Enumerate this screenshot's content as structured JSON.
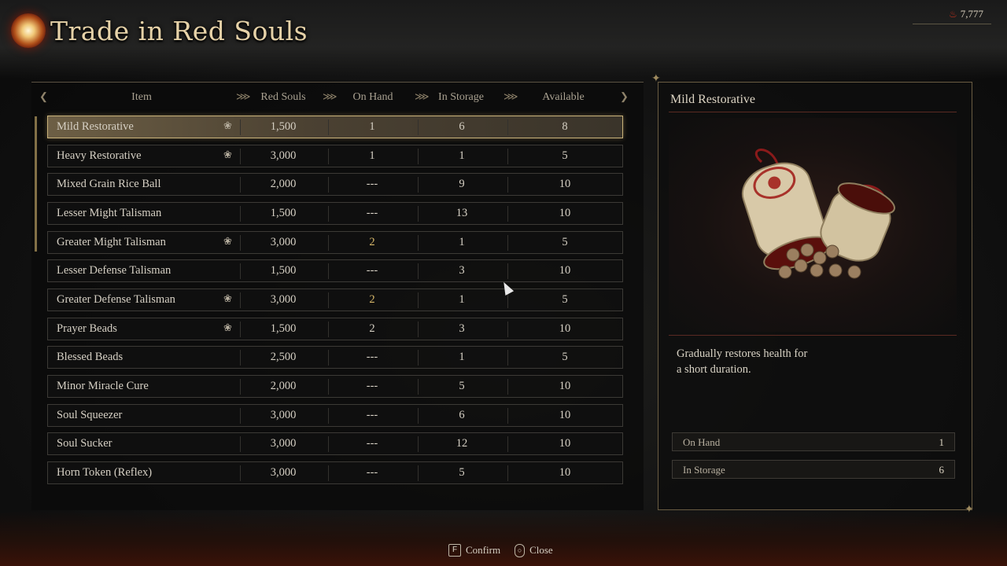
{
  "header": {
    "title": "Trade in Red Souls",
    "currency": "7,777",
    "icons": {
      "title_emblem": "red-soul-orb-icon",
      "currency": "red-soul-icon"
    }
  },
  "table": {
    "columns": [
      "Item",
      "Red Souls",
      "On Hand",
      "In Storage",
      "Available"
    ],
    "rows": [
      {
        "name": "Mild Restorative",
        "price": "1,500",
        "on_hand": "1",
        "in_storage": "6",
        "available": "8",
        "tagged": true,
        "selected": true,
        "on_hand_highlight": false
      },
      {
        "name": "Heavy Restorative",
        "price": "3,000",
        "on_hand": "1",
        "in_storage": "1",
        "available": "5",
        "tagged": true,
        "selected": false,
        "on_hand_highlight": false
      },
      {
        "name": "Mixed Grain Rice Ball",
        "price": "2,000",
        "on_hand": "---",
        "in_storage": "9",
        "available": "10",
        "tagged": false,
        "selected": false,
        "on_hand_highlight": false
      },
      {
        "name": "Lesser Might Talisman",
        "price": "1,500",
        "on_hand": "---",
        "in_storage": "13",
        "available": "10",
        "tagged": false,
        "selected": false,
        "on_hand_highlight": false
      },
      {
        "name": "Greater Might Talisman",
        "price": "3,000",
        "on_hand": "2",
        "in_storage": "1",
        "available": "5",
        "tagged": true,
        "selected": false,
        "on_hand_highlight": true
      },
      {
        "name": "Lesser Defense Talisman",
        "price": "1,500",
        "on_hand": "---",
        "in_storage": "3",
        "available": "10",
        "tagged": false,
        "selected": false,
        "on_hand_highlight": false
      },
      {
        "name": "Greater Defense Talisman",
        "price": "3,000",
        "on_hand": "2",
        "in_storage": "1",
        "available": "5",
        "tagged": true,
        "selected": false,
        "on_hand_highlight": true
      },
      {
        "name": "Prayer Beads",
        "price": "1,500",
        "on_hand": "2",
        "in_storage": "3",
        "available": "10",
        "tagged": true,
        "selected": false,
        "on_hand_highlight": false
      },
      {
        "name": "Blessed Beads",
        "price": "2,500",
        "on_hand": "---",
        "in_storage": "1",
        "available": "5",
        "tagged": false,
        "selected": false,
        "on_hand_highlight": false
      },
      {
        "name": "Minor Miracle Cure",
        "price": "2,000",
        "on_hand": "---",
        "in_storage": "5",
        "available": "10",
        "tagged": false,
        "selected": false,
        "on_hand_highlight": false
      },
      {
        "name": "Soul Squeezer",
        "price": "3,000",
        "on_hand": "---",
        "in_storage": "6",
        "available": "10",
        "tagged": false,
        "selected": false,
        "on_hand_highlight": false
      },
      {
        "name": "Soul Sucker",
        "price": "3,000",
        "on_hand": "---",
        "in_storage": "12",
        "available": "10",
        "tagged": false,
        "selected": false,
        "on_hand_highlight": false
      },
      {
        "name": "Horn Token (Reflex)",
        "price": "3,000",
        "on_hand": "---",
        "in_storage": "5",
        "available": "10",
        "tagged": false,
        "selected": false,
        "on_hand_highlight": false
      }
    ]
  },
  "detail": {
    "title": "Mild Restorative",
    "description_lines": [
      "Gradually restores health for",
      "a short duration."
    ],
    "stats": [
      {
        "label": "On Hand",
        "value": "1"
      },
      {
        "label": "In Storage",
        "value": "6"
      }
    ],
    "image_icon": "medicine-case-icon"
  },
  "footer": {
    "confirm_key": "F",
    "confirm_label": "Confirm",
    "close_key": "mouse-right-button-icon",
    "close_label": "Close"
  },
  "colors": {
    "selected_border": "#c9b27a",
    "highlight_number": "#d8b86a",
    "soul_red": "#c0301e"
  }
}
